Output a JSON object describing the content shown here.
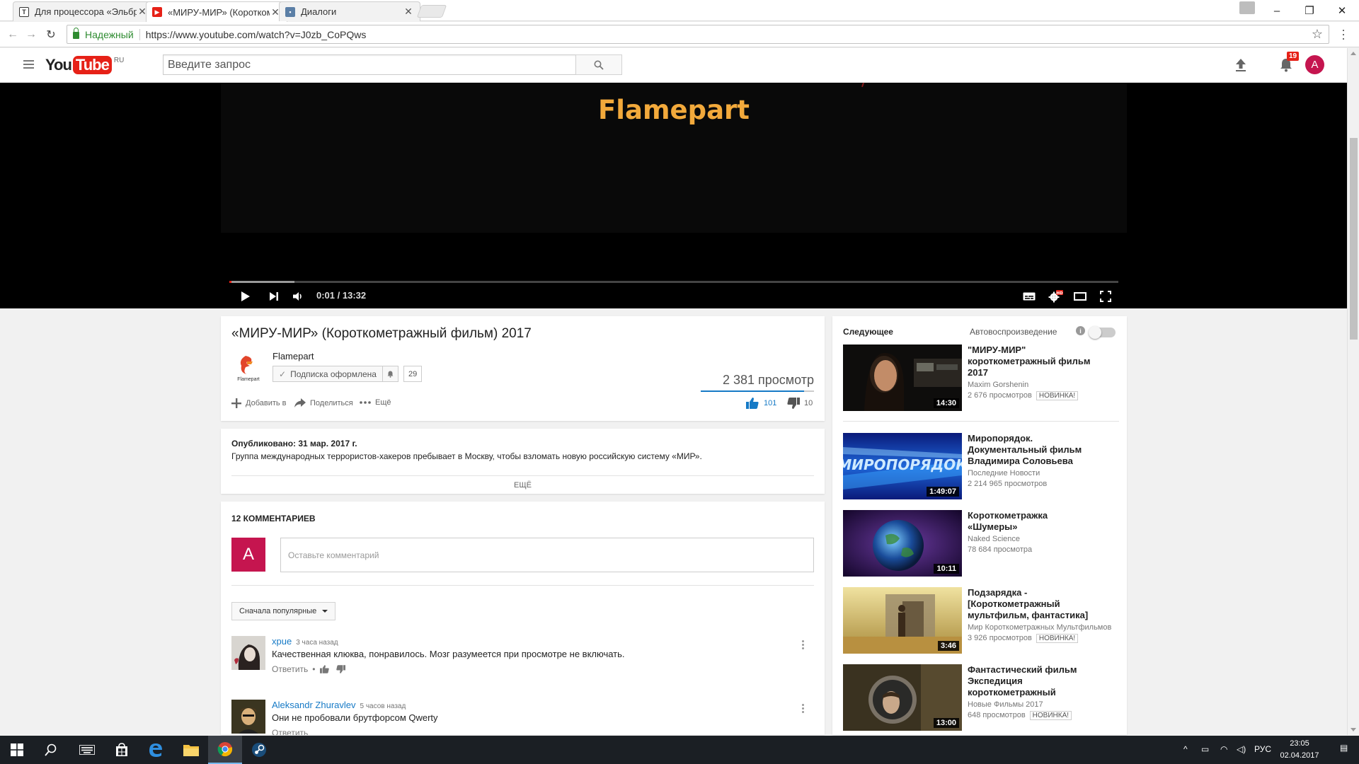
{
  "browser": {
    "tabs": [
      {
        "title": "Для процессора «Эльбр",
        "icon": "telegraph-icon",
        "active": false
      },
      {
        "title": "«МИРУ-МИР» (Короткоме",
        "icon": "youtube-icon",
        "active": true
      },
      {
        "title": "Диалоги",
        "icon": "vk-icon",
        "active": false
      }
    ],
    "secure_label": "Надежный",
    "url": "https://www.youtube.com/watch?v=J0zb_CoPQws"
  },
  "header": {
    "logo_you": "You",
    "logo_tube": "Tube",
    "region": "RU",
    "search_placeholder": "Введите запрос",
    "notifications_count": "19",
    "avatar_letter": "A"
  },
  "player": {
    "frame_text": "Flamepart",
    "current_time": "0:01",
    "duration": "13:32",
    "time_display": "0:01 / 13:32",
    "progress_fraction": 0.0012,
    "buffered_fraction": 0.073
  },
  "video": {
    "title": "«МИРУ-МИР» (Короткометражный фильм) 2017",
    "channel": "Flamepart",
    "channel_logo_text": "Flamepart",
    "subscribed_label": "Подписка оформлена",
    "subscriber_count": "29",
    "views": "2 381 просмотр",
    "like_ratio": 0.91,
    "actions": {
      "add": "Добавить в",
      "share": "Поделиться",
      "more": "Ещё"
    },
    "likes": "101",
    "dislikes": "10"
  },
  "description": {
    "published": "Опубликовано: 31 мар. 2017 г.",
    "text": "Группа международных террористов-хакеров пребывает в Москву, чтобы взломать новую российскую систему «МИР».",
    "more_label": "ЕЩЁ"
  },
  "comments": {
    "count_label": "12 КОММЕНТАРИЕВ",
    "input_placeholder": "Оставьте комментарий",
    "avatar_letter": "A",
    "sort_label": "Сначала популярные",
    "items": [
      {
        "author": "xpue",
        "time": "3 часа назад",
        "text": "Качественная клюква, понравилось. Мозг разумеется при просмотре не включать.",
        "reply": "Ответить"
      },
      {
        "author": "Aleksandr Zhuravlev",
        "time": "5 часов назад",
        "text": "Они не пробовали брутфорсом Qwerty",
        "reply": "Ответить"
      }
    ]
  },
  "sidebar": {
    "up_next": "Следующее",
    "autoplay": "Автовоспроизведение",
    "autoplay_on": false,
    "items": [
      {
        "title": "\"МИРУ-МИР\" короткометражный фильм 2017",
        "channel": "Maxim Gorshenin",
        "views": "2 676 просмотров",
        "badge": "НОВИНКА!",
        "duration": "14:30"
      },
      {
        "title": "Миропорядок. Документальный фильм Владимира Соловьева",
        "channel": "Последние Новости",
        "views": "2 214 965 просмотров",
        "badge": "",
        "duration": "1:49:07"
      },
      {
        "title": "Короткометражка «Шумеры»",
        "channel": "Naked Science",
        "views": "78 684 просмотра",
        "badge": "",
        "duration": "10:11"
      },
      {
        "title": "Подзарядка - [Короткометражный мультфильм, фантастика]",
        "channel": "Мир Короткометражных Мультфильмов",
        "views": "3 926 просмотров",
        "badge": "НОВИНКА!",
        "duration": "3:46"
      },
      {
        "title": "Фантастический фильм Экспедиция короткометражный",
        "channel": "Новые Фильмы 2017",
        "views": "648 просмотров",
        "badge": "НОВИНКА!",
        "duration": "13:00"
      }
    ]
  },
  "taskbar": {
    "language": "РУС",
    "time": "23:05",
    "date": "02.04.2017"
  },
  "colors": {
    "youtube_red": "#e62117",
    "link_blue": "#167ac6",
    "avatar_pink": "#c5154f",
    "flamepart_orange": "#f2a93b"
  }
}
